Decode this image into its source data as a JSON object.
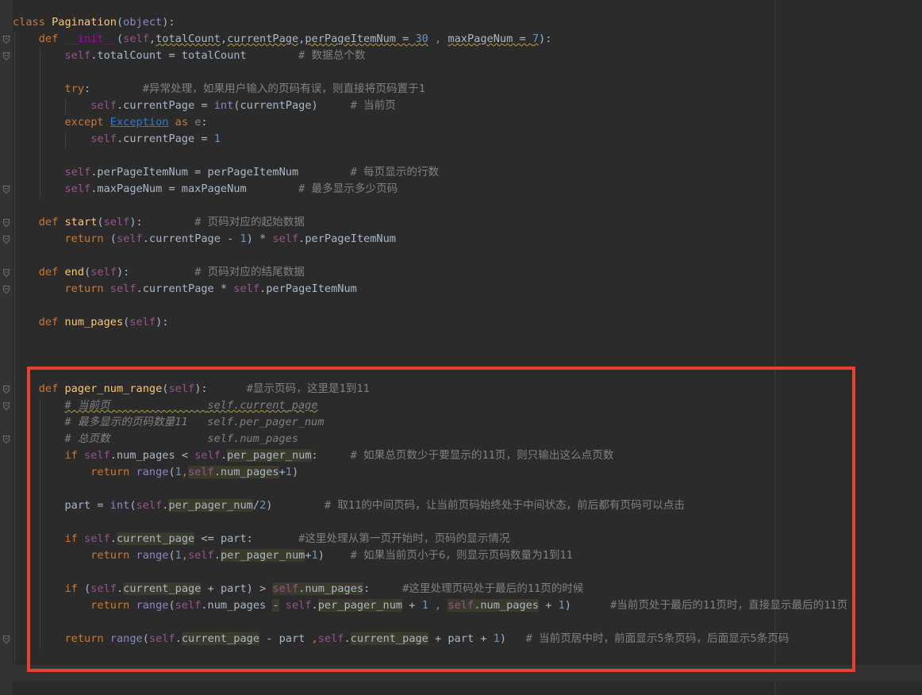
{
  "editor": {
    "language": "python",
    "class_name": "Pagination",
    "lines": [
      [
        {
          "t": "class ",
          "k": "kw"
        },
        {
          "t": "Pagination",
          "k": "fn"
        },
        {
          "t": "(",
          "k": ""
        },
        {
          "t": "object",
          "k": "bi"
        },
        {
          "t": "):",
          "k": ""
        }
      ],
      [
        {
          "t": "    ",
          "k": ""
        },
        {
          "t": "def ",
          "k": "kw"
        },
        {
          "t": "__init__",
          "k": "dn"
        },
        {
          "t": "(",
          "k": ""
        },
        {
          "t": "self",
          "k": "sf"
        },
        {
          "t": ",",
          "k": ""
        },
        {
          "t": "totalCount",
          "k": "wv"
        },
        {
          "t": ",",
          "k": ""
        },
        {
          "t": "currentPage",
          "k": "wv"
        },
        {
          "t": ",",
          "k": ""
        },
        {
          "t": "perPageItemNum = ",
          "k": "wv"
        },
        {
          "t": "30",
          "k": "num wv"
        },
        {
          "t": " , ",
          "k": "kw"
        },
        {
          "t": "maxPageNum = ",
          "k": "wv"
        },
        {
          "t": "7",
          "k": "num wv"
        },
        {
          "t": "):",
          "k": ""
        }
      ],
      [
        {
          "t": "        ",
          "k": ""
        },
        {
          "t": "self",
          "k": "sf"
        },
        {
          "t": ".totalCount = totalCount        ",
          "k": ""
        },
        {
          "t": "# 数据总个数",
          "k": "cm"
        }
      ],
      [],
      [
        {
          "t": "        ",
          "k": ""
        },
        {
          "t": "try",
          "k": "kw"
        },
        {
          "t": ":        ",
          "k": ""
        },
        {
          "t": "#异常处理，如果用户输入的页码有误，则直接将页码置于1",
          "k": "cm"
        }
      ],
      [
        {
          "t": "            ",
          "k": ""
        },
        {
          "t": "self",
          "k": "sf"
        },
        {
          "t": ".currentPage = ",
          "k": ""
        },
        {
          "t": "int",
          "k": "bi"
        },
        {
          "t": "(currentPage)     ",
          "k": ""
        },
        {
          "t": "# 当前页",
          "k": "cm"
        }
      ],
      [
        {
          "t": "        ",
          "k": ""
        },
        {
          "t": "except ",
          "k": "kw"
        },
        {
          "t": "Exception",
          "k": "lnk"
        },
        {
          "t": " as ",
          "k": "kw"
        },
        {
          "t": "e",
          "k": "cm"
        },
        {
          "t": ":",
          "k": ""
        }
      ],
      [
        {
          "t": "            ",
          "k": ""
        },
        {
          "t": "self",
          "k": "sf"
        },
        {
          "t": ".currentPage = ",
          "k": ""
        },
        {
          "t": "1",
          "k": "num"
        }
      ],
      [],
      [
        {
          "t": "        ",
          "k": ""
        },
        {
          "t": "self",
          "k": "sf"
        },
        {
          "t": ".perPageItemNum = perPageItemNum        ",
          "k": ""
        },
        {
          "t": "# 每页显示的行数",
          "k": "cm"
        }
      ],
      [
        {
          "t": "        ",
          "k": ""
        },
        {
          "t": "self",
          "k": "sf"
        },
        {
          "t": ".maxPageNum = maxPageNum        ",
          "k": ""
        },
        {
          "t": "# 最多显示多少页码",
          "k": "cm"
        }
      ],
      [],
      [
        {
          "t": "    ",
          "k": ""
        },
        {
          "t": "def ",
          "k": "kw"
        },
        {
          "t": "start",
          "k": "fn"
        },
        {
          "t": "(",
          "k": ""
        },
        {
          "t": "self",
          "k": "sf"
        },
        {
          "t": "):        ",
          "k": ""
        },
        {
          "t": "# 页码对应的起始数据",
          "k": "cm"
        }
      ],
      [
        {
          "t": "        ",
          "k": ""
        },
        {
          "t": "return ",
          "k": "kw"
        },
        {
          "t": "(",
          "k": ""
        },
        {
          "t": "self",
          "k": "sf"
        },
        {
          "t": ".currentPage - ",
          "k": ""
        },
        {
          "t": "1",
          "k": "num"
        },
        {
          "t": ") * ",
          "k": ""
        },
        {
          "t": "self",
          "k": "sf"
        },
        {
          "t": ".perPageItemNum",
          "k": ""
        }
      ],
      [],
      [
        {
          "t": "    ",
          "k": ""
        },
        {
          "t": "def ",
          "k": "kw"
        },
        {
          "t": "end",
          "k": "fn"
        },
        {
          "t": "(",
          "k": ""
        },
        {
          "t": "self",
          "k": "sf"
        },
        {
          "t": "):          ",
          "k": ""
        },
        {
          "t": "# 页码对应的结尾数据",
          "k": "cm"
        }
      ],
      [
        {
          "t": "        ",
          "k": ""
        },
        {
          "t": "return ",
          "k": "kw"
        },
        {
          "t": "self",
          "k": "sf"
        },
        {
          "t": ".currentPage * ",
          "k": ""
        },
        {
          "t": "self",
          "k": "sf"
        },
        {
          "t": ".perPageItemNum",
          "k": ""
        }
      ],
      [],
      [
        {
          "t": "    ",
          "k": ""
        },
        {
          "t": "def ",
          "k": "kw"
        },
        {
          "t": "num_pages",
          "k": "fn"
        },
        {
          "t": "(",
          "k": ""
        },
        {
          "t": "self",
          "k": "sf"
        },
        {
          "t": "):",
          "k": ""
        }
      ],
      [],
      [],
      [],
      [
        {
          "t": "    ",
          "k": ""
        },
        {
          "t": "def ",
          "k": "kw"
        },
        {
          "t": "pager_num_range",
          "k": "fn"
        },
        {
          "t": "(",
          "k": ""
        },
        {
          "t": "self",
          "k": "sf"
        },
        {
          "t": "):      ",
          "k": ""
        },
        {
          "t": "#显示页码，这里是1到11",
          "k": "cm"
        }
      ],
      [
        {
          "t": "        ",
          "k": ""
        },
        {
          "t": "# 当前页",
          "k": "cmi wv"
        },
        {
          "t": "               ",
          "k": "cmi wv"
        },
        {
          "t": "self.current_page",
          "k": "cmi wv"
        }
      ],
      [
        {
          "t": "        ",
          "k": ""
        },
        {
          "t": "# 最多显示的页码数量11   self.per_pager_num",
          "k": "cmi"
        }
      ],
      [
        {
          "t": "        ",
          "k": ""
        },
        {
          "t": "# 总页数               self.num_pages",
          "k": "cmi"
        }
      ],
      [
        {
          "t": "        ",
          "k": ""
        },
        {
          "t": "if ",
          "k": "kw"
        },
        {
          "t": "self",
          "k": "sf"
        },
        {
          "t": ".num_pages < ",
          "k": ""
        },
        {
          "t": "self",
          "k": "sf"
        },
        {
          "t": ".",
          "k": ""
        },
        {
          "t": "per_pager_num",
          "k": "hl"
        },
        {
          "t": ":     ",
          "k": ""
        },
        {
          "t": "# 如果总页数少于要显示的11页，则只输出这么点页数",
          "k": "cm"
        }
      ],
      [
        {
          "t": "            ",
          "k": ""
        },
        {
          "t": "return ",
          "k": "kw"
        },
        {
          "t": "range",
          "k": "bi"
        },
        {
          "t": "(",
          "k": ""
        },
        {
          "t": "1",
          "k": "num"
        },
        {
          "t": ",",
          "k": "kw"
        },
        {
          "t": "self",
          "k": "sf hl"
        },
        {
          "t": ".num_pages",
          "k": "hl"
        },
        {
          "t": "+",
          "k": ""
        },
        {
          "t": "1",
          "k": "num"
        },
        {
          "t": ")",
          "k": ""
        }
      ],
      [],
      [
        {
          "t": "        ",
          "k": ""
        },
        {
          "t": "part = ",
          "k": ""
        },
        {
          "t": "int",
          "k": "bi"
        },
        {
          "t": "(",
          "k": ""
        },
        {
          "t": "self",
          "k": "sf"
        },
        {
          "t": ".",
          "k": ""
        },
        {
          "t": "per_pager_num",
          "k": "hl"
        },
        {
          "t": "/",
          "k": ""
        },
        {
          "t": "2",
          "k": "num"
        },
        {
          "t": ")        ",
          "k": ""
        },
        {
          "t": "# 取11的中间页码，让当前页码始终处于中间状态，前后都有页码可以点击",
          "k": "cm"
        }
      ],
      [],
      [
        {
          "t": "        ",
          "k": ""
        },
        {
          "t": "if ",
          "k": "kw"
        },
        {
          "t": "self",
          "k": "sf"
        },
        {
          "t": ".",
          "k": ""
        },
        {
          "t": "current_page",
          "k": "hl"
        },
        {
          "t": " <= part:       ",
          "k": ""
        },
        {
          "t": "#这里处理从第一页开始时，页码的显示情况",
          "k": "cm"
        }
      ],
      [
        {
          "t": "            ",
          "k": ""
        },
        {
          "t": "return ",
          "k": "kw"
        },
        {
          "t": "range",
          "k": "bi"
        },
        {
          "t": "(",
          "k": ""
        },
        {
          "t": "1",
          "k": "num"
        },
        {
          "t": ",",
          "k": "kw"
        },
        {
          "t": "self",
          "k": "sf"
        },
        {
          "t": ".",
          "k": ""
        },
        {
          "t": "per_pager_num",
          "k": "hl"
        },
        {
          "t": "+",
          "k": ""
        },
        {
          "t": "1",
          "k": "num"
        },
        {
          "t": ")    ",
          "k": ""
        },
        {
          "t": "# 如果当前页小于6，则显示页码数量为1到11",
          "k": "cm"
        }
      ],
      [],
      [
        {
          "t": "        ",
          "k": ""
        },
        {
          "t": "if ",
          "k": "kw"
        },
        {
          "t": "(",
          "k": ""
        },
        {
          "t": "self",
          "k": "sf"
        },
        {
          "t": ".",
          "k": ""
        },
        {
          "t": "current_page",
          "k": "hl"
        },
        {
          "t": " + part) > ",
          "k": ""
        },
        {
          "t": "self",
          "k": "sf hl"
        },
        {
          "t": ".num_pages",
          "k": "hl"
        },
        {
          "t": ":     ",
          "k": ""
        },
        {
          "t": "#这里处理页码处于最后的11页的时候",
          "k": "cm"
        }
      ],
      [
        {
          "t": "            ",
          "k": ""
        },
        {
          "t": "return ",
          "k": "kw"
        },
        {
          "t": "range",
          "k": "bi"
        },
        {
          "t": "(",
          "k": ""
        },
        {
          "t": "self",
          "k": "sf"
        },
        {
          "t": ".num_pages ",
          "k": ""
        },
        {
          "t": "-",
          "k": "hl"
        },
        {
          "t": " ",
          "k": ""
        },
        {
          "t": "self",
          "k": "sf"
        },
        {
          "t": ".",
          "k": ""
        },
        {
          "t": "per_pager_num",
          "k": "hl"
        },
        {
          "t": " + ",
          "k": ""
        },
        {
          "t": "1",
          "k": "num"
        },
        {
          "t": " , ",
          "k": "kw"
        },
        {
          "t": "self",
          "k": "sf hl"
        },
        {
          "t": ".num_pages",
          "k": "hl"
        },
        {
          "t": " + ",
          "k": ""
        },
        {
          "t": "1",
          "k": "num"
        },
        {
          "t": ")      ",
          "k": ""
        },
        {
          "t": "#当前页处于最后的11页时，直接显示最后的11页",
          "k": "cm"
        }
      ],
      [],
      [
        {
          "t": "        ",
          "k": ""
        },
        {
          "t": "return ",
          "k": "kw"
        },
        {
          "t": "range",
          "k": "bi"
        },
        {
          "t": "(",
          "k": ""
        },
        {
          "t": "self",
          "k": "sf"
        },
        {
          "t": ".",
          "k": ""
        },
        {
          "t": "current_page",
          "k": "hl"
        },
        {
          "t": " - part ",
          "k": ""
        },
        {
          "t": ",",
          "k": "kw"
        },
        {
          "t": "self",
          "k": "sf"
        },
        {
          "t": ".",
          "k": ""
        },
        {
          "t": "current_page",
          "k": "hl"
        },
        {
          "t": " + part + ",
          "k": ""
        },
        {
          "t": "1",
          "k": "num"
        },
        {
          "t": ")   ",
          "k": ""
        },
        {
          "t": "# 当前页居中时，前面显示5条页码，后面显示5条页码",
          "k": "cm"
        }
      ],
      [],
      []
    ]
  },
  "colors": {
    "background": "#2b2b2b",
    "keyword": "#cc7832",
    "self": "#94558d",
    "number": "#6897bb",
    "function": "#ffc66d",
    "comment": "#808080",
    "highlight_box": "#e8412f"
  }
}
